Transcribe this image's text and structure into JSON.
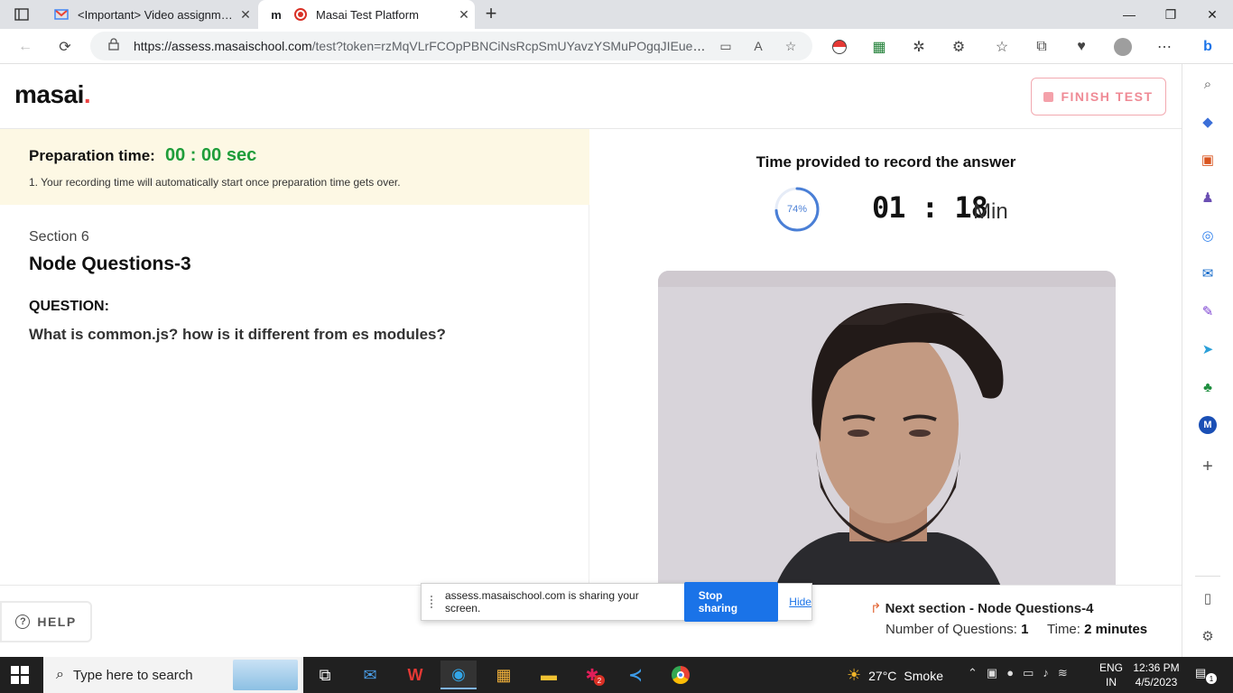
{
  "browser": {
    "tabs": [
      {
        "title": "<Important> Video assignment",
        "favicon": "gmail-icon",
        "active": false
      },
      {
        "title": "Masai Test Platform",
        "favicon": "masai-icon",
        "active": true
      }
    ],
    "url_host": "https://assess.masaischool.com",
    "url_rest": "/test?token=rzMqVLrFCOpPBNCiNsRcpSmUYavzYSMuPOgqJIEueUEq..."
  },
  "header": {
    "logo": "masai",
    "logo_dot": ".",
    "finish_label": "FINISH TEST"
  },
  "prep": {
    "label": "Preparation time:",
    "time": "00 : 00 sec",
    "note": "1. Your recording time will automatically start once preparation time gets over."
  },
  "question": {
    "section": "Section 6",
    "section_title": "Node Questions-3",
    "label": "QUESTION:",
    "text": "What is common.js? how is it different from es modules?"
  },
  "recording": {
    "title": "Time provided to record the answer",
    "progress_percent": 74,
    "progress_label": "74%",
    "timer": "01 : 18",
    "timer_unit": "Min"
  },
  "footer": {
    "help_label": "HELP",
    "next_section": "Next section - Node Questions-4",
    "questions_label": "Number of Questions:",
    "questions_value": "1",
    "time_label": "Time:",
    "time_value": "2 minutes"
  },
  "share_bar": {
    "message": "assess.masaischool.com is sharing your screen.",
    "stop_label": "Stop sharing",
    "hide_label": "Hide"
  },
  "taskbar": {
    "search_placeholder": "Type here to search",
    "weather_temp": "27°C",
    "weather_desc": "Smoke",
    "lang_line1": "ENG",
    "lang_line2": "IN",
    "time": "12:36 PM",
    "date": "4/5/2023",
    "notification_count": "1",
    "slack_badge": "2"
  },
  "colors": {
    "accent_green": "#1f9d3a",
    "finish_pink": "#ef8a95",
    "prep_bg": "#fdf8e4",
    "share_blue": "#1a73e8"
  }
}
